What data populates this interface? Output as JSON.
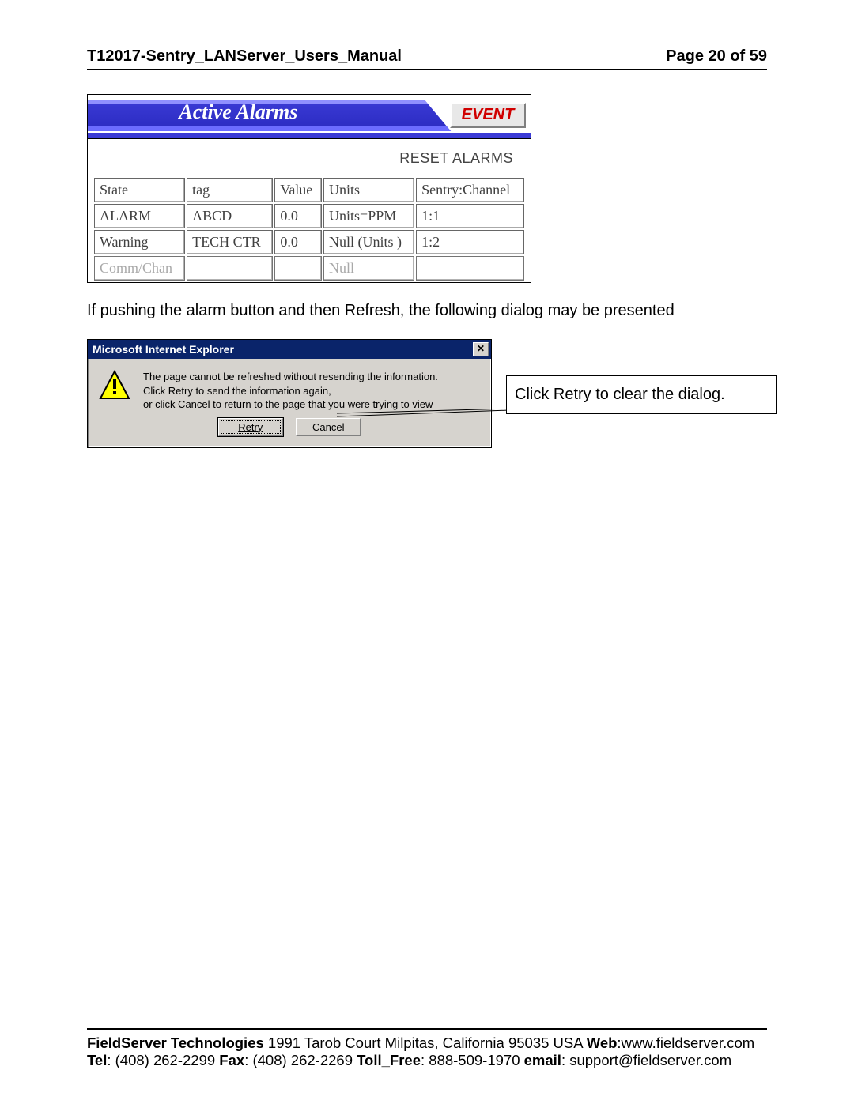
{
  "header": {
    "title": "T12017-Sentry_LANServer_Users_Manual",
    "page_label": "Page 20 of 59"
  },
  "alarm_screenshot": {
    "banner_title": "Active Alarms",
    "event_button": "EVENT",
    "reset_button": "RESET ALARMS",
    "columns": [
      "State",
      "tag",
      "Value",
      "Units",
      "Sentry:Channel"
    ],
    "rows": [
      {
        "state": "ALARM",
        "tag": "ABCD",
        "value": "0.0",
        "units": "Units=PPM",
        "sentry": "1:1"
      },
      {
        "state": "Warning",
        "tag": "TECH CTR",
        "value": "0.0",
        "units": "Null (Units )",
        "sentry": "1:2"
      },
      {
        "state": "Comm/Chan",
        "tag": "",
        "value": "",
        "units": "Null",
        "sentry": ""
      }
    ]
  },
  "body_paragraph": "If pushing the alarm button and then Refresh, the following dialog may be presented",
  "dialog": {
    "title": "Microsoft Internet Explorer",
    "line1": "The page cannot be refreshed without resending the information.",
    "line2": "Click Retry to send the information again,",
    "line3": "or click Cancel to return to the page that you were trying to view",
    "retry_label": "Retry",
    "cancel_label": "Cancel"
  },
  "callout": "Click Retry to clear the dialog.",
  "footer": {
    "line1_a": "FieldServer Technologies",
    "line1_b": " 1991 Tarob Court Milpitas, California 95035 USA  ",
    "web_label": "Web",
    "web_value": ":www.fieldserver.com",
    "tel_label": "Tel",
    "tel_value": ": (408) 262-2299   ",
    "fax_label": "Fax",
    "fax_value": ": (408) 262-2269   ",
    "toll_label": "Toll_Free",
    "toll_value": ": 888-509-1970   ",
    "email_label": "email",
    "email_value": ": support@fieldserver.com"
  }
}
